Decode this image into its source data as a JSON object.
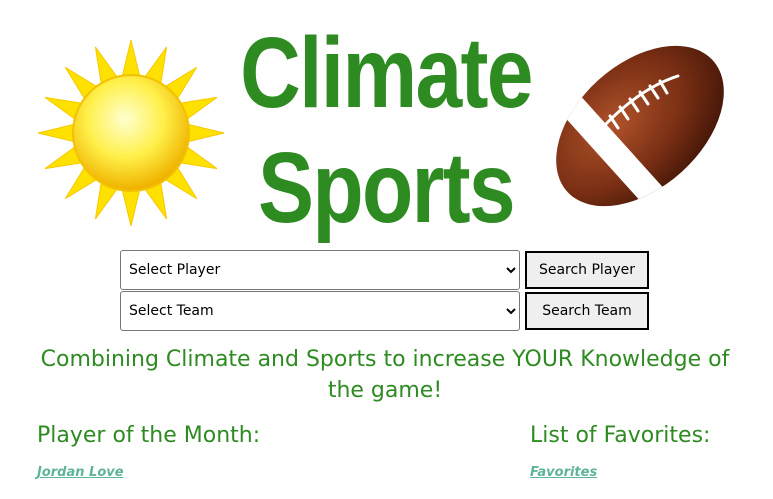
{
  "header": {
    "title_line1": "Climate",
    "title_line2": "Sports",
    "left_image_icon": "sun-icon",
    "right_image_icon": "football-icon"
  },
  "search": {
    "player_select": {
      "selected": "Select Player",
      "options": [
        "Select Player"
      ]
    },
    "player_button": "Search Player",
    "team_select": {
      "selected": "Select Team",
      "options": [
        "Select Team"
      ]
    },
    "team_button": "Search Team"
  },
  "tagline": "Combining Climate and Sports to increase YOUR Knowledge of the game!",
  "player_of_month": {
    "heading": "Player of the Month:",
    "link_text": "Jordan Love"
  },
  "favorites": {
    "heading": "List of Favorites:",
    "link_text": "Favorites"
  },
  "colors": {
    "title_green": "#2e8b22",
    "link_teal": "#5fb39a",
    "sun_yellow": "#ffe600",
    "ball_brown": "#6e2a12"
  }
}
